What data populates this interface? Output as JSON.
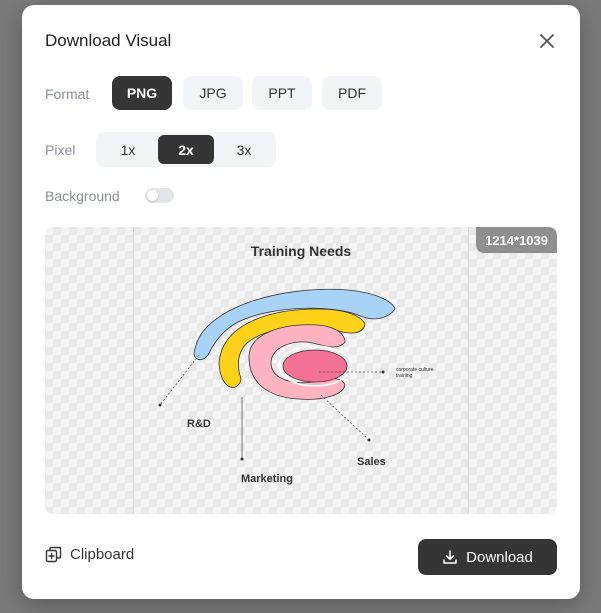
{
  "dialog": {
    "title": "Download Visual"
  },
  "format": {
    "label": "Format",
    "options": [
      "PNG",
      "JPG",
      "PPT",
      "PDF"
    ],
    "selected": "PNG"
  },
  "pixel": {
    "label": "Pixel",
    "options": [
      "1x",
      "2x",
      "3x"
    ],
    "selected": "2x"
  },
  "background": {
    "label": "Background",
    "enabled": false
  },
  "preview": {
    "dimensions": "1214*1039",
    "chart_title": "Training Needs",
    "labels": {
      "rd": "R&D",
      "marketing": "Marketing",
      "sales": "Sales",
      "culture_line1": "corporate culture",
      "culture_line2": "training"
    },
    "colors": {
      "rd": "#a9d2f7",
      "marketing": "#ffd21a",
      "sales": "#ffb3c1",
      "culture": "#f47296"
    }
  },
  "actions": {
    "clipboard_label": "Clipboard",
    "download_label": "Download"
  },
  "icons": {
    "close": "close-icon",
    "clipboard": "clipboard-icon",
    "download": "download-icon"
  }
}
